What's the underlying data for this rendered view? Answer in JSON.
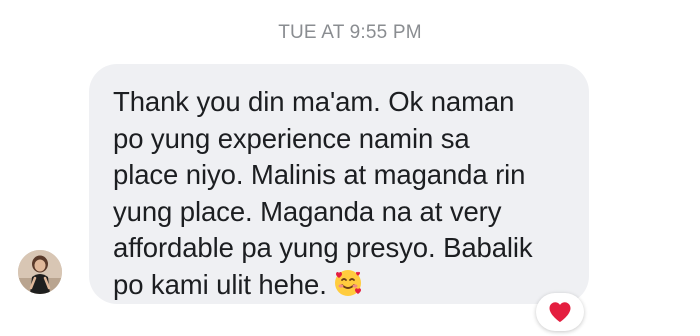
{
  "conversation": {
    "timestamp": "TUE AT 9:55 PM",
    "message": {
      "text": "Thank you din ma'am. Ok naman\npo yung experience namin sa\nplace niyo. Malinis at maganda rin\nyung place. Maganda na at very\naffordable pa yung presyo. Babalik\npo kami ulit hehe.",
      "emoji": "smiling-face-with-hearts",
      "bubble_color": "#eff0f3",
      "text_color": "#1c1e21"
    },
    "sender_avatar": "avatar-photo",
    "reaction": {
      "icon": "heart-icon",
      "color": "#e41e3f"
    },
    "timestamp_color": "#8a8d91"
  }
}
